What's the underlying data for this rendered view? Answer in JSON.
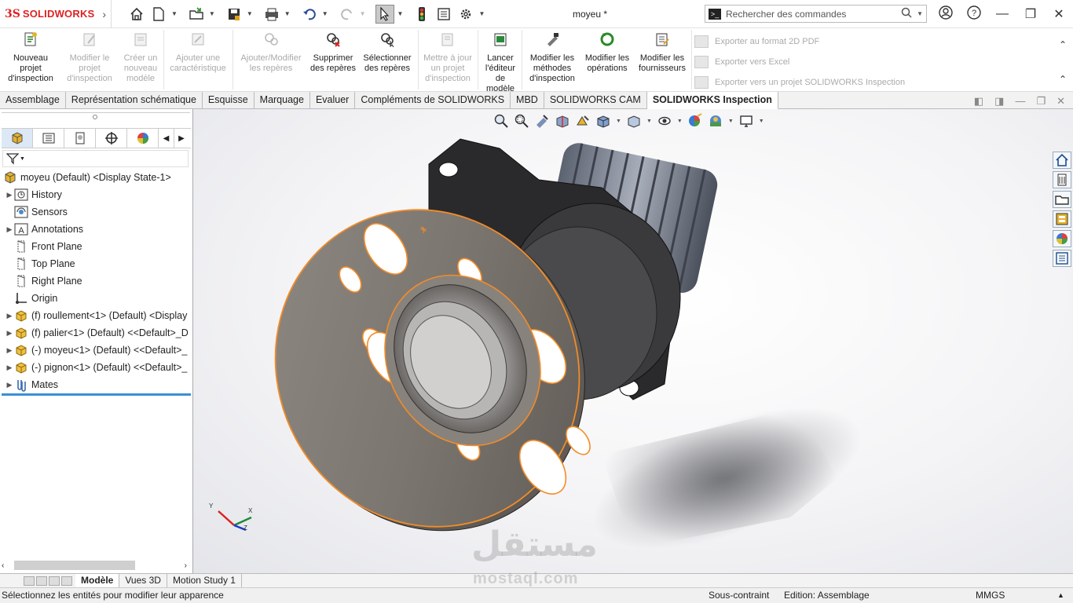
{
  "app": {
    "logo_prefix": "3S",
    "logo_text": "SOLIDWORKS",
    "doc_title": "moyeu *"
  },
  "search": {
    "placeholder": "Rechercher des commandes"
  },
  "ribbon": {
    "buttons": [
      {
        "label": "Nouveau projet d'inspection",
        "enabled": true
      },
      {
        "label": "Modifier le projet d'inspection",
        "enabled": false
      },
      {
        "label": "Créer un nouveau modèle",
        "enabled": false
      },
      {
        "label": "Ajouter une caractéristique",
        "enabled": false
      },
      {
        "label": "Ajouter/Modifier les repères",
        "enabled": false
      },
      {
        "label": "Supprimer des repères",
        "enabled": true
      },
      {
        "label": "Sélectionner des repères",
        "enabled": true
      },
      {
        "label": "Mettre à jour un projet d'inspection",
        "enabled": false
      },
      {
        "label": "Lancer l'éditeur de modèle",
        "enabled": true
      },
      {
        "label": "Modifier les méthodes d'inspection",
        "enabled": true
      },
      {
        "label": "Modifier les opérations",
        "enabled": true
      },
      {
        "label": "Modifier les fournisseurs",
        "enabled": true
      }
    ],
    "exports": [
      "Exporter au format 2D PDF",
      "Exporter vers Excel",
      "Exporter vers un projet SOLIDWORKS Inspection"
    ]
  },
  "tabs": [
    "Assemblage",
    "Représentation schématique",
    "Esquisse",
    "Marquage",
    "Evaluer",
    "Compléments de SOLIDWORKS",
    "MBD",
    "SOLIDWORKS CAM",
    "SOLIDWORKS Inspection"
  ],
  "active_tab": "SOLIDWORKS Inspection",
  "tree": {
    "root": "moyeu (Default) <Display State-1>",
    "items": [
      {
        "label": "History",
        "expandable": true,
        "icon": "history-icon"
      },
      {
        "label": "Sensors",
        "expandable": false,
        "icon": "sensors-icon"
      },
      {
        "label": "Annotations",
        "expandable": true,
        "icon": "annotations-icon"
      },
      {
        "label": "Front Plane",
        "expandable": false,
        "icon": "plane-icon"
      },
      {
        "label": "Top Plane",
        "expandable": false,
        "icon": "plane-icon"
      },
      {
        "label": "Right Plane",
        "expandable": false,
        "icon": "plane-icon"
      },
      {
        "label": "Origin",
        "expandable": false,
        "icon": "origin-icon"
      },
      {
        "label": "(f) roullement<1> (Default) <Display",
        "expandable": true,
        "icon": "part-icon"
      },
      {
        "label": "(f) palier<1> (Default) <<Default>_D",
        "expandable": true,
        "icon": "part-icon"
      },
      {
        "label": "(-) moyeu<1> (Default) <<Default>_",
        "expandable": true,
        "icon": "part-icon"
      },
      {
        "label": "(-) pignon<1> (Default) <<Default>_",
        "expandable": true,
        "icon": "part-icon"
      },
      {
        "label": "Mates",
        "expandable": true,
        "icon": "mates-icon"
      }
    ]
  },
  "bottom_tabs": [
    "",
    "Modèle",
    "Vues 3D",
    "Motion Study 1"
  ],
  "status": {
    "message": "Sélectionnez les entités pour modifier leur apparence",
    "constraint": "Sous-contraint",
    "mode": "Edition: Assemblage",
    "units": "MMGS"
  },
  "triad": {
    "x": "X",
    "y": "Y",
    "z": "Z"
  },
  "watermark": {
    "arabic": "مستقل",
    "latin": "mostaql.com"
  },
  "colors": {
    "accent": "#3b8ed6",
    "brand": "#d22222",
    "selection": "#f28c28"
  }
}
